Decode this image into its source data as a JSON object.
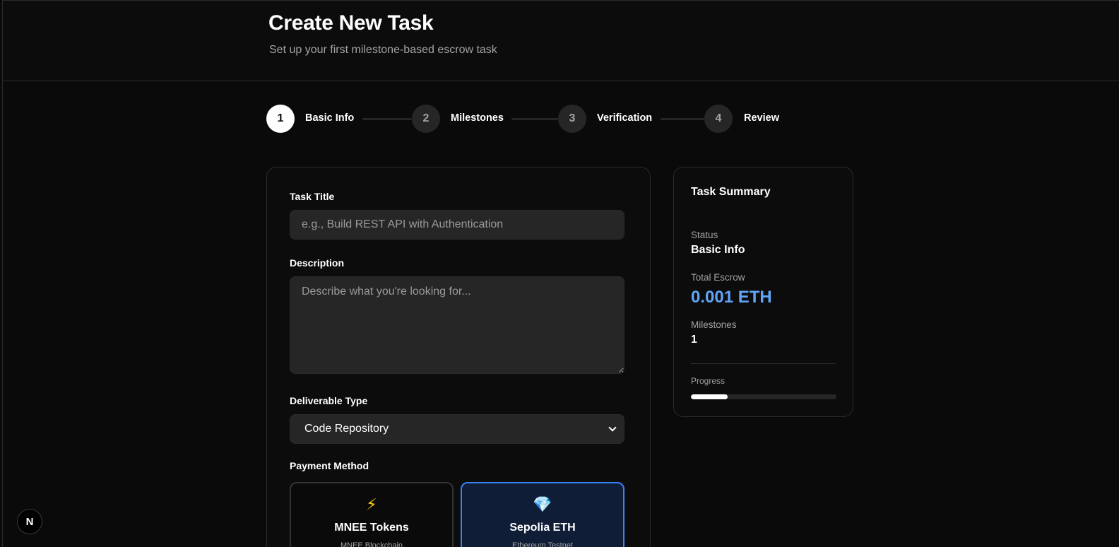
{
  "header": {
    "title": "Create New Task",
    "subtitle": "Set up your first milestone-based escrow task"
  },
  "stepper": {
    "current": 1,
    "steps": [
      {
        "number": "1",
        "label": "Basic Info"
      },
      {
        "number": "2",
        "label": "Milestones"
      },
      {
        "number": "3",
        "label": "Verification"
      },
      {
        "number": "4",
        "label": "Review"
      }
    ]
  },
  "form": {
    "title_label": "Task Title",
    "title_placeholder": "e.g., Build REST API with Authentication",
    "title_value": "",
    "description_label": "Description",
    "description_placeholder": "Describe what you're looking for...",
    "description_value": "",
    "deliverable_label": "Deliverable Type",
    "deliverable_selected": "Code Repository",
    "payment_label": "Payment Method",
    "payment_options": [
      {
        "icon": "lightning-bolt-icon",
        "glyph": "⚡",
        "title": "MNEE Tokens",
        "subtitle": "MNEE Blockchain",
        "selected": false
      },
      {
        "icon": "gem-icon",
        "glyph": "💎",
        "title": "Sepolia ETH",
        "subtitle": "Ethereum Testnet",
        "selected": true
      }
    ]
  },
  "summary": {
    "title": "Task Summary",
    "status_label": "Status",
    "status_value": "Basic Info",
    "escrow_label": "Total Escrow",
    "escrow_value": "0.001 ETH",
    "milestones_label": "Milestones",
    "milestones_value": "1",
    "progress_label": "Progress",
    "progress_fraction": 0.25
  },
  "badge": {
    "icon": "nextjs-logo-icon",
    "glyph": "N"
  },
  "colors": {
    "accent_blue": "#3b82f6",
    "escrow_text": "#60a5fa",
    "background": "#0a0a0a"
  }
}
